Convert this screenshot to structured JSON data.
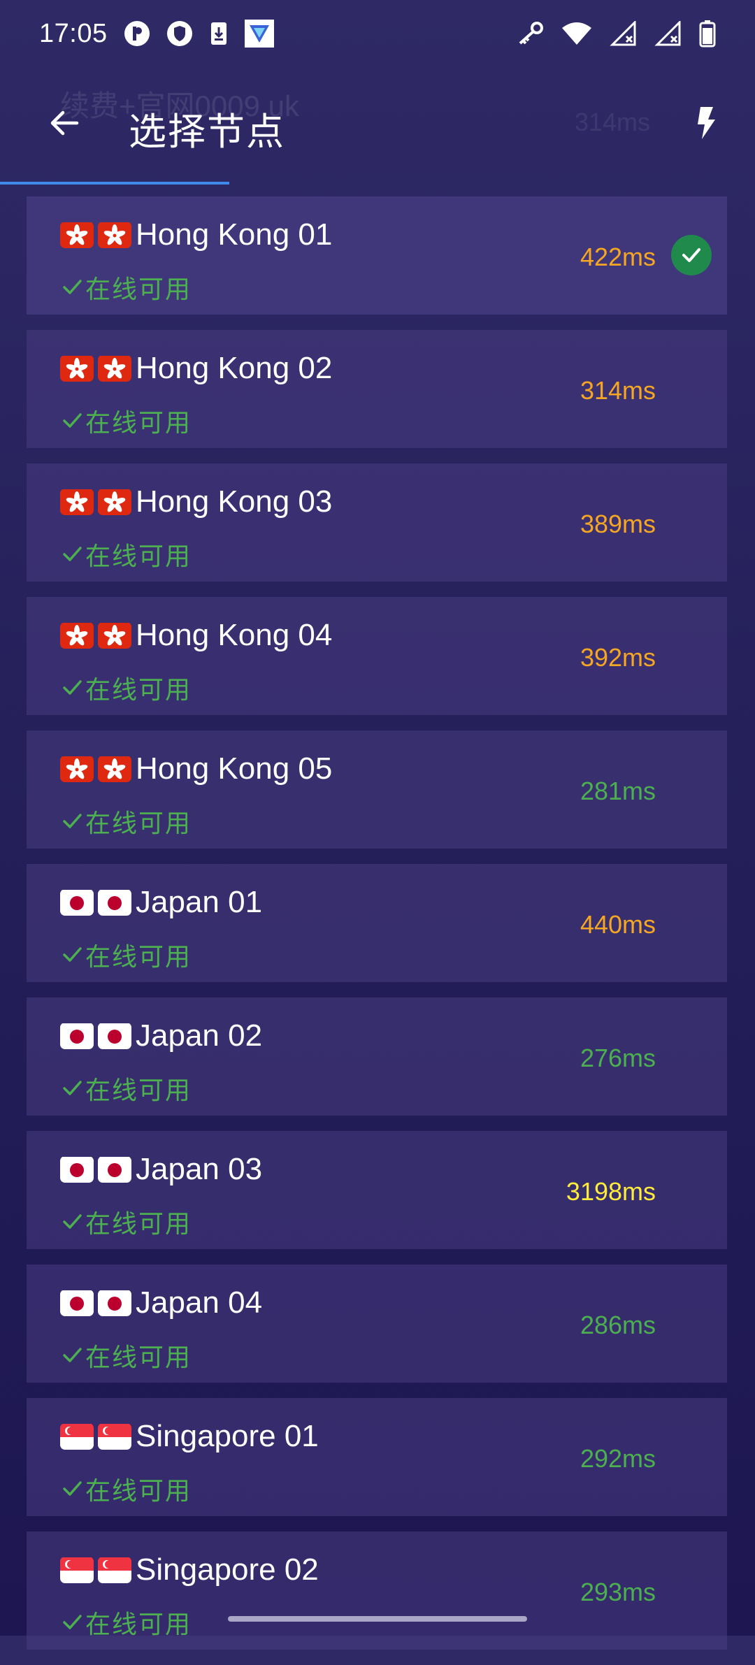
{
  "status_bar": {
    "time": "17:05",
    "left_icons": [
      "p-circle-icon",
      "shield-icon",
      "download-box-icon",
      "vpn-app-icon"
    ],
    "right_icons": [
      "key-icon",
      "wifi-icon",
      "signal-off-icon",
      "signal-off-icon",
      "battery-icon"
    ]
  },
  "app_bar": {
    "title": "选择节点",
    "ghost_text": "续费+官网0009.uk",
    "ghost_latency": "314ms",
    "back_icon": "back-arrow-icon",
    "action_icon": "flash-icon",
    "accent": "#3f8ae8"
  },
  "colors": {
    "background": "#29225e",
    "card": "#3b3274",
    "online_green": "#4caf50",
    "latency_orange": "#f5a623",
    "latency_green": "#4caf50",
    "latency_yellow": "#ffeb3b",
    "selected_badge": "#1f8a4c"
  },
  "servers": [
    {
      "name": "Hong Kong 01",
      "flag": "hk",
      "status": "在线可用",
      "latency": "422ms",
      "latency_level": "orange",
      "selected": true
    },
    {
      "name": "Hong Kong 02",
      "flag": "hk",
      "status": "在线可用",
      "latency": "314ms",
      "latency_level": "orange",
      "selected": false
    },
    {
      "name": "Hong Kong 03",
      "flag": "hk",
      "status": "在线可用",
      "latency": "389ms",
      "latency_level": "orange",
      "selected": false
    },
    {
      "name": "Hong Kong 04",
      "flag": "hk",
      "status": "在线可用",
      "latency": "392ms",
      "latency_level": "orange",
      "selected": false
    },
    {
      "name": "Hong Kong 05",
      "flag": "hk",
      "status": "在线可用",
      "latency": "281ms",
      "latency_level": "green",
      "selected": false
    },
    {
      "name": "Japan 01",
      "flag": "jp",
      "status": "在线可用",
      "latency": "440ms",
      "latency_level": "orange",
      "selected": false
    },
    {
      "name": "Japan 02",
      "flag": "jp",
      "status": "在线可用",
      "latency": "276ms",
      "latency_level": "green",
      "selected": false
    },
    {
      "name": "Japan 03",
      "flag": "jp",
      "status": "在线可用",
      "latency": "3198ms",
      "latency_level": "yellow",
      "selected": false
    },
    {
      "name": "Japan 04",
      "flag": "jp",
      "status": "在线可用",
      "latency": "286ms",
      "latency_level": "green",
      "selected": false
    },
    {
      "name": "Singapore 01",
      "flag": "sg",
      "status": "在线可用",
      "latency": "292ms",
      "latency_level": "green",
      "selected": false
    },
    {
      "name": "Singapore 02",
      "flag": "sg",
      "status": "在线可用",
      "latency": "293ms",
      "latency_level": "green",
      "selected": false
    }
  ]
}
